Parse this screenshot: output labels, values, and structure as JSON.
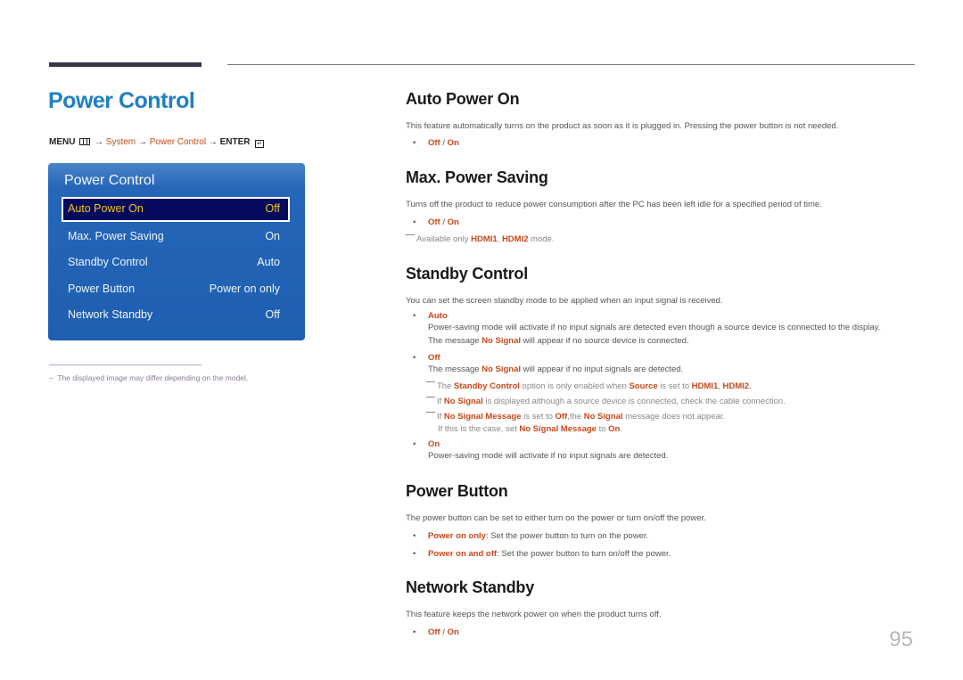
{
  "page": {
    "title": "Power Control",
    "page_number": "95",
    "menu_path": {
      "menu": "MENU",
      "arrow": "→",
      "system": "System",
      "power_control": "Power Control",
      "enter": "ENTER",
      "enter_glyph": "↵"
    },
    "footnote": "The displayed image may differ depending on the model.",
    "footnote_dash": "–"
  },
  "osd": {
    "title": "Power Control",
    "rows": [
      {
        "label": "Auto Power On",
        "value": "Off",
        "selected": true
      },
      {
        "label": "Max. Power Saving",
        "value": "On"
      },
      {
        "label": "Standby Control",
        "value": "Auto"
      },
      {
        "label": "Power Button",
        "value": "Power on only"
      },
      {
        "label": "Network Standby",
        "value": "Off"
      }
    ]
  },
  "sections": {
    "auto_power_on": {
      "heading": "Auto Power On",
      "desc": "This feature automatically turns on the product as soon as it is plugged in. Pressing the power button is not needed.",
      "opt_off": "Off",
      "sep": " / ",
      "opt_on": "On"
    },
    "max_power_saving": {
      "heading": "Max. Power Saving",
      "desc": "Turns off the product to reduce power consumption after the PC has been left idle for a specified period of time.",
      "opt_off": "Off",
      "sep": " / ",
      "opt_on": "On",
      "note_pre": "Available only ",
      "note_hdmi1": "HDMI1",
      "note_comma": ", ",
      "note_hdmi2": "HDMI2",
      "note_post": " mode."
    },
    "standby_control": {
      "heading": "Standby Control",
      "desc": "You can set the screen standby mode to be applied when an input signal is received.",
      "auto_label": "Auto",
      "auto_line1": "Power-saving mode will activate if no input signals are detected even though a source device is connected to the display.",
      "auto_line2_pre": "The message ",
      "no_signal": "No Signal",
      "auto_line2_post": " will appear if no source device is connected.",
      "off_label": "Off",
      "off_line_pre": "The message ",
      "off_line_post": " will appear if no input signals are detected.",
      "note1_pre": "The ",
      "note1_sc": "Standby Control",
      "note1_mid": " option is only enabled when ",
      "note1_source": "Source",
      "note1_mid2": " is set to ",
      "note1_hdmi1": "HDMI1",
      "note1_comma": ", ",
      "note1_hdmi2": "HDMI2",
      "note1_end": ".",
      "note2_pre": "If ",
      "note2_post": " is displayed although a source device is connected, check the cable connection.",
      "note3_pre": "If ",
      "no_signal_message": "No Signal Message",
      "note3_mid": " is set to ",
      "note3_off": "Off",
      "note3_mid2": ",the ",
      "note3_post": " message does not appear.",
      "note3b_pre": "If this is the case, set ",
      "note3b_mid": " to ",
      "note3b_on": "On",
      "note3b_end": ".",
      "on_label": "On",
      "on_line": "Power-saving mode will activate if no input signals are detected."
    },
    "power_button": {
      "heading": "Power Button",
      "desc": "The power button can be set to either turn on the power or turn on/off the power.",
      "opt1_label": "Power on only",
      "opt1_text": ": Set the power button to turn on the power.",
      "opt2_label": "Power on and off",
      "opt2_text": ": Set the power button to turn on/off the power."
    },
    "network_standby": {
      "heading": "Network Standby",
      "desc": "This feature keeps the network power on when the product turns off.",
      "opt_off": "Off",
      "sep": " / ",
      "opt_on": "On"
    }
  },
  "colors": {
    "title_blue": "#1f7fc4",
    "highlight_orange": "#c8481a",
    "osd_blue": "#1e5fb2",
    "osd_selected_bg": "#060a5e",
    "osd_selected_text": "#f0c419"
  }
}
